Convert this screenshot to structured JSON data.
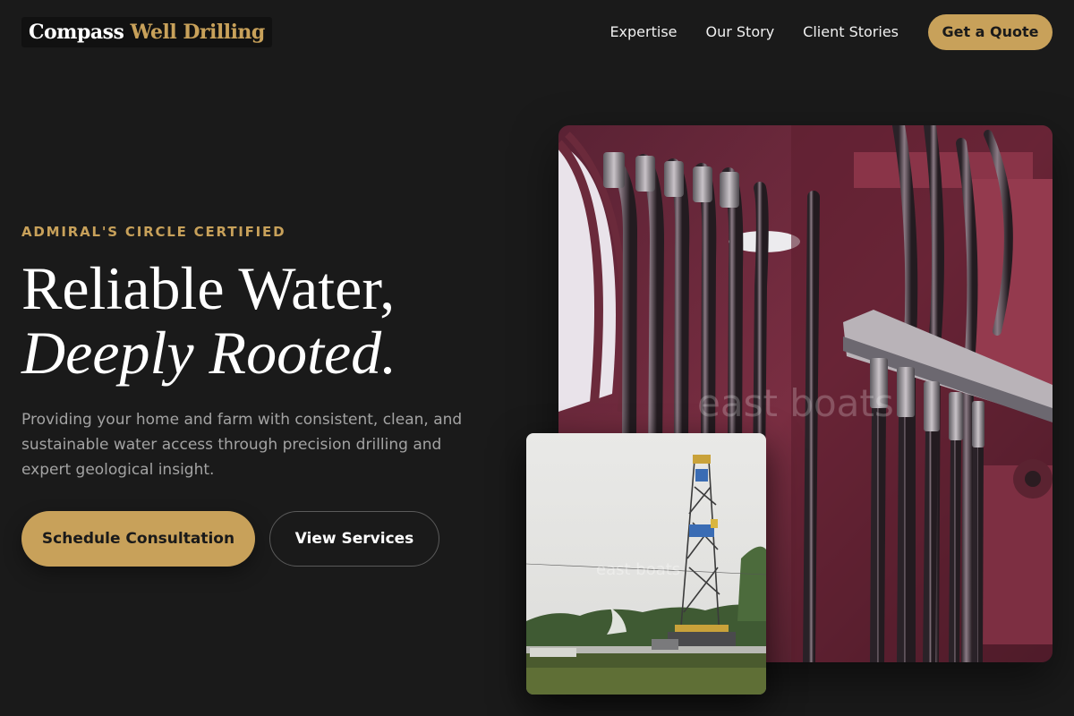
{
  "nav": {
    "logo_part1": "Compass",
    "logo_part2": "Well Drilling",
    "links": [
      "Expertise",
      "Our Story",
      "Client Stories"
    ],
    "cta": "Get a Quote"
  },
  "hero": {
    "eyebrow": "ADMIRAL'S CIRCLE CERTIFIED",
    "headline_line1": "Reliable Water,",
    "headline_line2": "Deeply Rooted.",
    "subtext": "Providing your home and farm with consistent, clean, and sustainable water access through precision drilling and expert geological insight.",
    "primary_button": "Schedule Consultation",
    "secondary_button": "View Services"
  },
  "images": {
    "main_watermark": "east boats",
    "secondary_watermark": "east boats"
  },
  "colors": {
    "background": "#1a1a1a",
    "accent": "#c8a15a",
    "muted_text": "#a3a3a3"
  }
}
